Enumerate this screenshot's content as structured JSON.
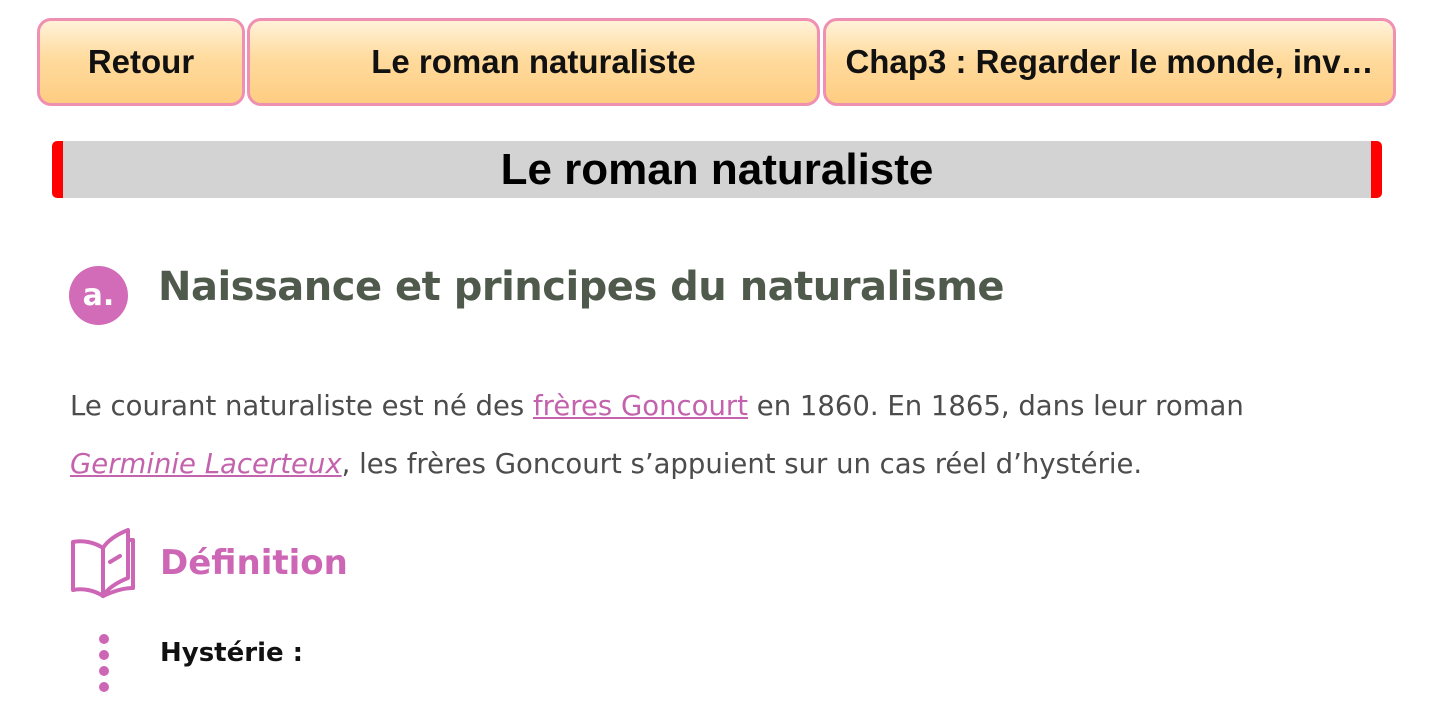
{
  "nav": {
    "back_label": "Retour",
    "lesson_label": "Le roman naturaliste",
    "chapter_label": "Chap3 : Regarder le monde, inv…"
  },
  "page": {
    "title": "Le roman naturaliste"
  },
  "section": {
    "badge": "a.",
    "title": "Naissance et principes du naturalisme"
  },
  "paragraph": {
    "text_1": "Le courant naturaliste est né des ",
    "link_goncourt": "frères Goncourt",
    "text_2": " en 1860. En 1865, dans leur roman ",
    "link_germinie": "Germinie Lacerteux",
    "text_3": ", les frères Goncourt s’appuient sur un cas réel d’hystérie."
  },
  "definition": {
    "icon": "book-icon",
    "title": "Définition",
    "term": "Hystérie :"
  },
  "colors": {
    "accent_pink": "#cc66b5",
    "button_border": "#ef8fb2",
    "button_fill": "#fecd82",
    "title_bar_bg": "#d3d3d3",
    "title_bar_edge": "#ff0000",
    "heading_text": "#4f5a4d"
  }
}
